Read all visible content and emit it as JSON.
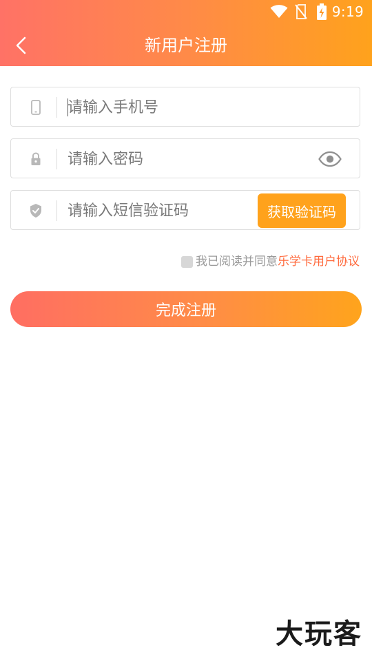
{
  "status_bar": {
    "time": "9:19",
    "icons": [
      "wifi-icon",
      "no-sim-icon",
      "battery-charging-icon"
    ]
  },
  "header": {
    "title": "新用户注册",
    "back_icon": "chevron-left-icon"
  },
  "form": {
    "phone": {
      "placeholder": "请输入手机号",
      "value": "",
      "icon": "phone-icon"
    },
    "password": {
      "placeholder": "请输入密码",
      "value": "",
      "icon": "lock-icon",
      "toggle_icon": "eye-icon"
    },
    "sms_code": {
      "placeholder": "请输入短信验证码",
      "value": "",
      "icon": "shield-icon",
      "button_label": "获取验证码"
    }
  },
  "agreement": {
    "text": "我已阅读并同意",
    "link": "乐学卡用户协议",
    "checked": false
  },
  "submit": {
    "label": "完成注册"
  },
  "watermark": {
    "text": "大玩客"
  },
  "colors": {
    "header_gradient_start": "#ff7266",
    "header_gradient_end": "#ffa21c",
    "accent_orange": "#ffa21c",
    "link_color": "#ff6a3d",
    "placeholder_gray": "#7a7a7a"
  }
}
